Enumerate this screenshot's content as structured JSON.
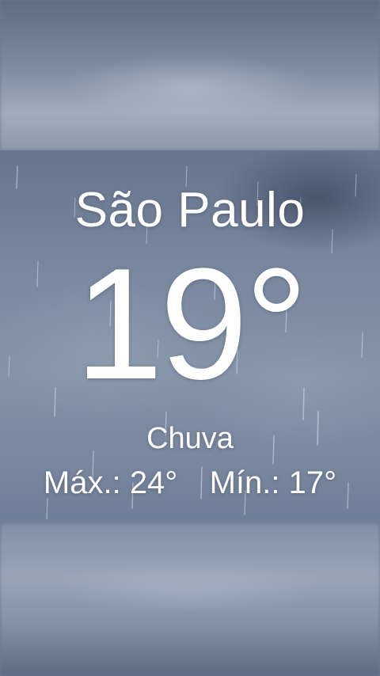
{
  "weather": {
    "city": "São Paulo",
    "temperature": "19°",
    "condition": "Chuva",
    "high_label": "Máx.:",
    "high_value": "24°",
    "low_label": "Mín.:",
    "low_value": "17°"
  },
  "colors": {
    "text": "#ffffff",
    "sky_dark": "#5f6d82",
    "sky_light": "#a2adbd"
  }
}
